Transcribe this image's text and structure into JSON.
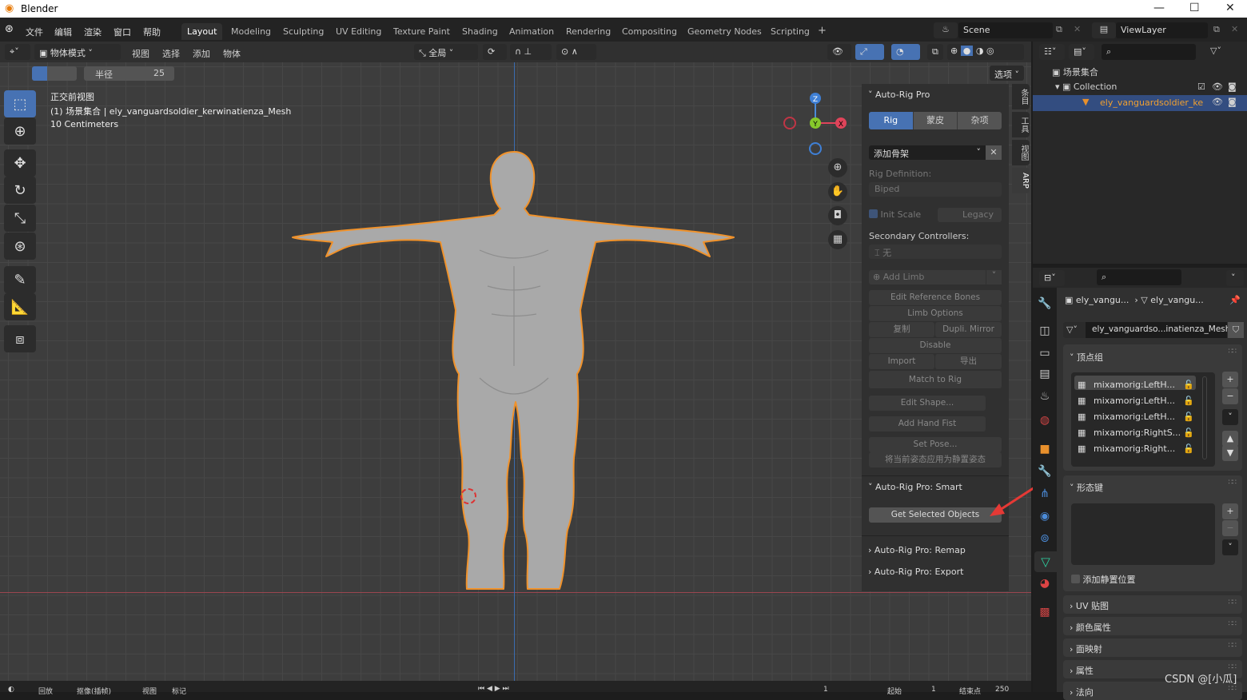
{
  "window": {
    "title": "Blender",
    "controls": [
      "—",
      "☐",
      "✕"
    ]
  },
  "menu": [
    "文件",
    "编辑",
    "渲染",
    "窗口",
    "帮助"
  ],
  "workspaces": [
    "Layout",
    "Modeling",
    "Sculpting",
    "UV Editing",
    "Texture Paint",
    "Shading",
    "Animation",
    "Rendering",
    "Compositing",
    "Geometry Nodes",
    "Scripting",
    "+"
  ],
  "scene": {
    "name": "Scene",
    "view_layer": "ViewLayer"
  },
  "viewport_header": {
    "mode": "物体模式",
    "menus": [
      "视图",
      "选择",
      "添加",
      "物体"
    ],
    "transform": "全局",
    "options": "选项"
  },
  "tool_settings": {
    "radius_label": "半径",
    "radius_value": "25"
  },
  "overlay_text": {
    "view": "正交前视图",
    "collection": "(1) 场景集合 | ely_vanguardsoldier_kerwinatienza_Mesh",
    "scale": "10 Centimeters"
  },
  "gizmo": {
    "x": "X",
    "y": "Y",
    "z": "Z"
  },
  "npanel": {
    "tabs": [
      "条目",
      "工具",
      "视图",
      "ARP"
    ],
    "title": "Auto-Rig Pro",
    "subtabs": [
      "Rig",
      "蒙皮",
      "杂项"
    ],
    "add_armature": "添加骨架",
    "rig_def_label": "Rig Definition:",
    "rig_def_value": "Biped",
    "init_scale": "Init Scale",
    "legacy": "Legacy",
    "secondary_label": "Secondary Controllers:",
    "secondary_value": "无",
    "add_limb": "Add Limb",
    "edit_ref": "Edit Reference Bones",
    "limb_options": "Limb Options",
    "copy": "复制",
    "dupli_mirror": "Dupli. Mirror",
    "disable": "Disable",
    "import": "Import",
    "export": "导出",
    "match_rig": "Match to Rig",
    "edit_shape": "Edit Shape...",
    "add_hand_fist": "Add Hand Fist",
    "set_pose": "Set Pose...",
    "apply_pose": "将当前姿态应用为静置姿态",
    "smart_title": "Auto-Rig Pro: Smart",
    "get_selected": "Get Selected Objects",
    "remap_title": "Auto-Rig Pro: Remap",
    "export_title": "Auto-Rig Pro: Export"
  },
  "outliner": {
    "root": "场景集合",
    "collection": "Collection",
    "object": "ely_vanguardsoldier_ke"
  },
  "properties": {
    "breadcrumb": [
      "ely_vangu...",
      "ely_vangu..."
    ],
    "mesh_name": "ely_vanguardso...inatienza_Mesh",
    "vertex_groups_title": "顶点组",
    "vertex_groups": [
      "mixamorig:LeftH...",
      "mixamorig:LeftH...",
      "mixamorig:LeftH...",
      "mixamorig:RightS...",
      "mixamorig:Right..."
    ],
    "shape_keys_title": "形态键",
    "add_rest": "添加静置位置",
    "sections": [
      "UV 贴图",
      "颜色属性",
      "面映射",
      "属性",
      "法向"
    ]
  },
  "timeline": {
    "menus": [
      "回放",
      "抠像(插帧)",
      "视图",
      "标记"
    ],
    "start_label": "起始",
    "start": "1",
    "end_label": "结束点",
    "end": "250",
    "current": "1"
  },
  "watermark": "CSDN @[小瓜]",
  "colors": {
    "accent": "#4772b3",
    "selection": "#f0922b",
    "annotation": "#e53935"
  }
}
